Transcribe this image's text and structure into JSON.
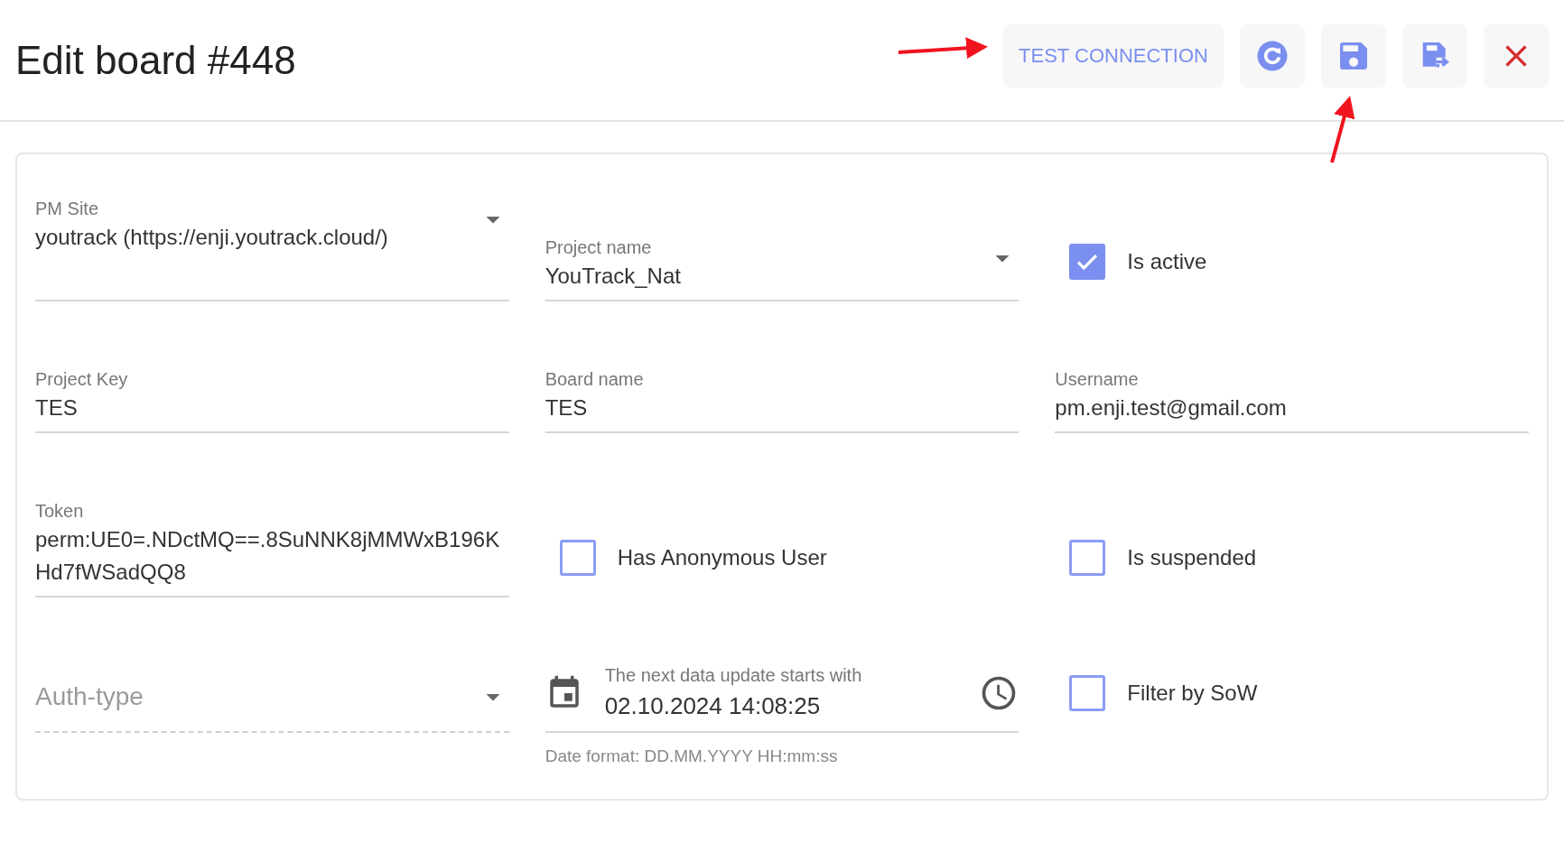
{
  "title": "Edit board #448",
  "toolbar": [
    {
      "kind": "text",
      "label": "TEST CONNECTION"
    },
    {
      "kind": "refresh"
    },
    {
      "kind": "save"
    },
    {
      "kind": "save-as"
    },
    {
      "kind": "close"
    }
  ],
  "fields": [
    {
      "kind": "select",
      "label": "PM Site",
      "value": "youtrack (https://enji.youtrack.cloud/)",
      "disabled": false
    },
    {
      "kind": "select",
      "label": "Project name",
      "value": "YouTrack_Nat",
      "disabled": false
    },
    {
      "kind": "checkbox",
      "label": "Is active",
      "checked": true
    },
    {
      "kind": "text",
      "label": "Project Key",
      "value": "TES"
    },
    {
      "kind": "text",
      "label": "Board name",
      "value": "TES"
    },
    {
      "kind": "text",
      "label": "Username",
      "value": "pm.enji.test@gmail.com"
    },
    {
      "kind": "text",
      "label": "Token",
      "value": "perm:UE0=.NDctMQ==.8SuNNK8jMMWxB196KHd7fWSadQQ8"
    },
    {
      "kind": "checkbox",
      "label": "Has Anonymous User",
      "checked": false
    },
    {
      "kind": "checkbox",
      "label": "Is suspended",
      "checked": false
    },
    {
      "kind": "select",
      "placeholder": "Auth-type",
      "disabled": true
    },
    {
      "kind": "datetime",
      "label": "The next data update starts with",
      "value": "02.10.2024 14:08:25",
      "helper": "Date format: DD.MM.YYYY HH:mm:ss"
    },
    {
      "kind": "checkbox",
      "label": "Filter by SoW",
      "checked": false
    }
  ]
}
